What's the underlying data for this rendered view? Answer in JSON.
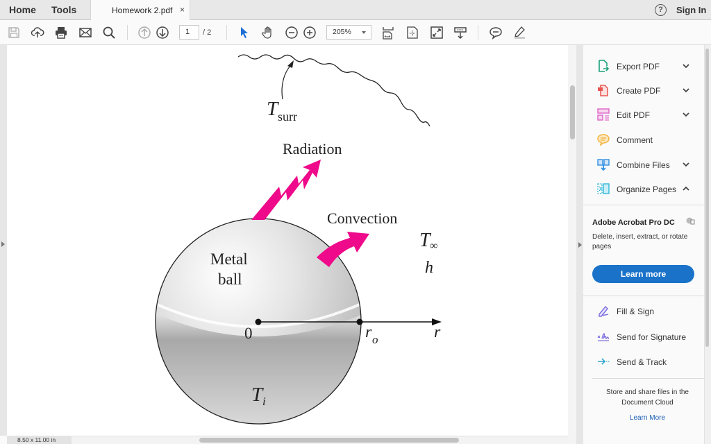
{
  "top_tabs": {
    "home": "Home",
    "tools": "Tools",
    "document": {
      "name": "Homework 2.pdf",
      "close": "×"
    },
    "help": "?",
    "sign_in": "Sign In"
  },
  "toolbar": {
    "icons": [
      "save-icon",
      "upload-cloud-icon",
      "print-icon",
      "email-icon",
      "search-icon",
      "page-up-icon",
      "page-down-icon",
      "select-cursor-icon",
      "hand-icon",
      "zoom-out-icon",
      "zoom-in-icon",
      "fit-page-icon",
      "page-layout-icon",
      "fullscreen-icon",
      "read-mode-icon",
      "comment-icon",
      "highlight-icon"
    ],
    "current_page": "1",
    "page_total": "/ 2",
    "zoom_level": "205%"
  },
  "figure": {
    "t_surr_main": "T",
    "t_surr_sub": "surr",
    "radiation": "Radiation",
    "convection": "Convection",
    "t_inf_main": "T",
    "t_inf_sub": "∞",
    "h": "h",
    "ball_line1": "Metal",
    "ball_line2": "ball",
    "origin": "0",
    "r_o_main": "r",
    "r_o_sub": "o",
    "r": "r",
    "t_i_main": "T",
    "t_i_sub": "i",
    "arrow_color": "#ee0a8a"
  },
  "status": {
    "page_size": "8.50 x 11.00 in"
  },
  "right_pane": {
    "tools": [
      {
        "label": "Export PDF",
        "icon": "export-pdf-icon",
        "color": "#1aa07a",
        "expand": "down"
      },
      {
        "label": "Create PDF",
        "icon": "create-pdf-icon",
        "color": "#e8544f",
        "expand": "down"
      },
      {
        "label": "Edit PDF",
        "icon": "edit-pdf-icon",
        "color": "#e064c8",
        "expand": "down"
      },
      {
        "label": "Comment",
        "icon": "comment-icon",
        "color": "#f2b33c",
        "expand": ""
      },
      {
        "label": "Combine Files",
        "icon": "combine-files-icon",
        "color": "#2f8fe0",
        "expand": "down"
      },
      {
        "label": "Organize Pages",
        "icon": "organize-pages-icon",
        "color": "#2fb7d9",
        "expand": "up"
      }
    ],
    "promo": {
      "title": "Adobe Acrobat Pro DC",
      "description": "Delete, insert, extract, or rotate pages",
      "button": "Learn more",
      "accent": "#1a73c9"
    },
    "sign_tools": [
      {
        "label": "Fill & Sign",
        "icon": "fill-sign-icon",
        "color": "#7a6ee0"
      },
      {
        "label": "Send for Signature",
        "icon": "send-signature-icon",
        "color": "#7a6ee0"
      },
      {
        "label": "Send & Track",
        "icon": "send-track-icon",
        "color": "#2fa8d0"
      }
    ],
    "cloud": {
      "text": "Store and share files in the Document Cloud",
      "link": "Learn More"
    }
  }
}
